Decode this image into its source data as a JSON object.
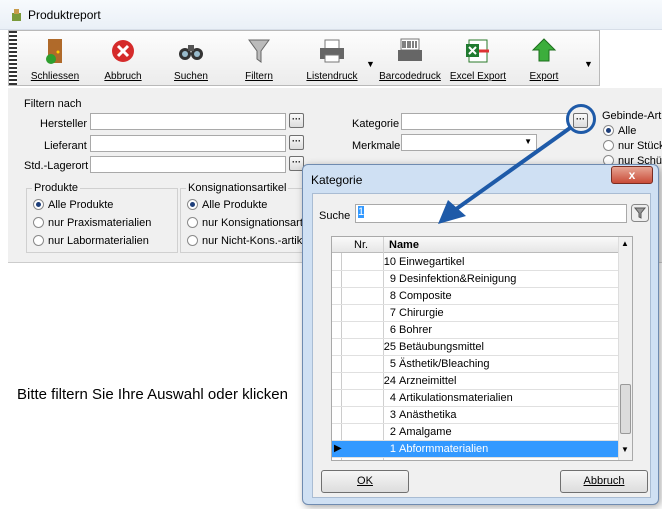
{
  "window": {
    "title": "Produktreport"
  },
  "toolbar": {
    "buttons": [
      {
        "label": "Schliessen",
        "icon": "door-exit-icon"
      },
      {
        "label": "Abbruch",
        "icon": "cancel-icon"
      },
      {
        "label": "Suchen",
        "icon": "binoculars-icon"
      },
      {
        "label": "Filtern",
        "icon": "filter-icon"
      },
      {
        "label": "Listendruck",
        "icon": "printer-icon"
      },
      {
        "label": "Barcodedruck",
        "icon": "barcode-printer-icon"
      },
      {
        "label": "Excel Export",
        "icon": "excel-icon"
      },
      {
        "label": "Export",
        "icon": "export-arrow-icon"
      }
    ]
  },
  "filters": {
    "heading": "Filtern nach",
    "hersteller": "Hersteller",
    "lieferant": "Lieferant",
    "lagerort": "Std.-Lagerort",
    "kategorie": "Kategorie",
    "merkmale": "Merkmale",
    "gebinde_label": "Gebinde-Art",
    "gebinde_options": [
      "Alle",
      "nur Stück",
      "nur Schü"
    ],
    "produkte_label": "Produkte",
    "produkte_options": [
      "Alle Produkte",
      "nur Praxismaterialien",
      "nur Labormaterialien"
    ],
    "konsignation_label": "Konsignationsartikel",
    "konsignation_options": [
      "Alle Produkte",
      "nur Konsignationsartikel",
      "nur Nicht-Kons.-artikel"
    ]
  },
  "main": {
    "message": "Bitte filtern Sie Ihre Auswahl oder klicken"
  },
  "dialog": {
    "title": "Kategorie",
    "close": "x",
    "search_label": "Suche",
    "search_value": "1",
    "col_nr": "Nr.",
    "col_name": "Name",
    "rows": [
      {
        "nr": "10",
        "name": "Einwegartikel"
      },
      {
        "nr": "9",
        "name": "Desinfektion&Reinigung"
      },
      {
        "nr": "8",
        "name": "Composite"
      },
      {
        "nr": "7",
        "name": "Chirurgie"
      },
      {
        "nr": "6",
        "name": "Bohrer"
      },
      {
        "nr": "25",
        "name": "Betäubungsmittel"
      },
      {
        "nr": "5",
        "name": "Ästhetik/Bleaching"
      },
      {
        "nr": "24",
        "name": "Arzneimittel"
      },
      {
        "nr": "4",
        "name": "Artikulationsmaterialien"
      },
      {
        "nr": "3",
        "name": "Anästhetika"
      },
      {
        "nr": "2",
        "name": "Amalgame"
      },
      {
        "nr": "1",
        "name": "Abformmaterialien"
      }
    ],
    "ok": "OK",
    "cancel": "Abbruch"
  }
}
